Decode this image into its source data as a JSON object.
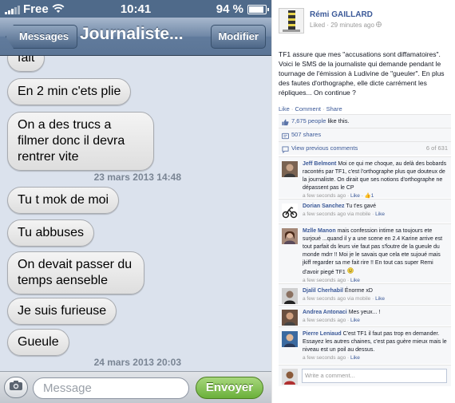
{
  "phone": {
    "status": {
      "carrier": "Free",
      "time": "10:41",
      "battery": "94 %",
      "battery_level": 0.94
    },
    "nav": {
      "back_label": "Messages",
      "title": "Journaliste...",
      "edit_label": "Modifier"
    },
    "messages": [
      {
        "text": "fait"
      },
      {
        "text": "En 2 min c'ets plie"
      },
      {
        "text": "On a des trucs a filmer donc il devra rentrer vite"
      },
      {
        "text": "Tu t mok de moi"
      },
      {
        "text": "Tu abbuses"
      },
      {
        "text": "On devait passer du temps aenseble"
      },
      {
        "text": "Je suis furieuse"
      },
      {
        "text": "Gueule"
      }
    ],
    "timestamps": [
      "23 mars 2013 14:48",
      "24 mars 2013 20:03"
    ],
    "input": {
      "placeholder": "Message",
      "send_label": "Envoyer"
    }
  },
  "facebook": {
    "author": "Rémi GAILLARD",
    "meta": "Liked · 29 minutes ago",
    "post_text": "TF1 assure que mes \"accusations sont diffamatoires\". Voici le SMS de la journaliste qui demande pendant le tournage de l'émission à Ludivine de \"gueuler\". En plus des fautes d'orthographe, elle dicte carrément les répliques... On continue ?",
    "actions": {
      "like": "Like",
      "comment": "Comment",
      "share": "Share"
    },
    "likes": {
      "count": "7,675 people",
      "suffix": " like this."
    },
    "shares": "507 shares",
    "view_previous": "View previous comments",
    "comment_count": "6 of 631",
    "comments": [
      {
        "name": "Jeff Belmont",
        "text": "Moi ce qui me choque, au delà des bobards racontés par TF1, c'est l'orthographe plus que douteux de la journaliste. On dirait que ses notions d'orthographe ne dépassent pas le CP",
        "time": "a few seconds ago · ",
        "actions": "Like · ",
        "likes": "1"
      },
      {
        "name": "Dorian Sanchez",
        "text": "Tu t'es gavé",
        "time": "a few seconds ago via mobile · ",
        "actions": "Like"
      },
      {
        "name": "Mzlle Manon",
        "text": "mais confession intime sa toujours ete surjoué ...quand il y a une scene en 2.4 Karine arrive est tout parfait ds leurs vie faut pas s'foutre de la gueule du monde mdrr !! Moi je le savais que cela ete sujoué mais jkiff regarder sa me fait rire !! En tout cas super Remi d'avoir piegé TF1",
        "time": "a few seconds ago · ",
        "actions": "Like"
      },
      {
        "name": "Djalil Cherhabil",
        "text": "Énorme xD",
        "time": "a few seconds ago via mobile · ",
        "actions": "Like"
      },
      {
        "name": "Andrea Antonaci",
        "text": "Mes yeux... !",
        "time": "a few seconds ago · ",
        "actions": "Like"
      },
      {
        "name": "Pierre Leniaud",
        "text": "C'est TF1 il faut pas trop en demander. Essayez les autres chaines, c'est pas guère mieux mais le niveau est un poil au dessus.",
        "time": "a few seconds ago · ",
        "actions": "Like"
      }
    ],
    "write_placeholder": "Write a comment..."
  }
}
